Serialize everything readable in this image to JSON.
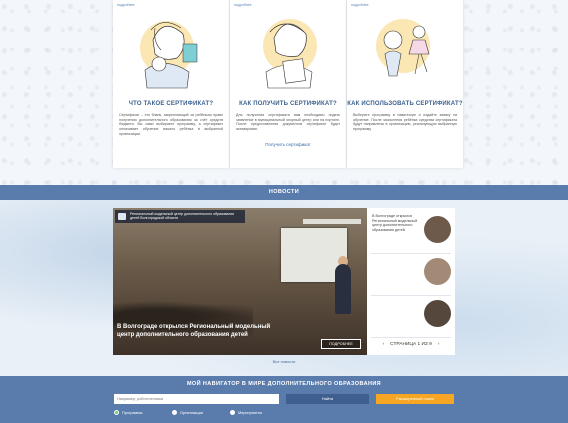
{
  "cards": [
    {
      "tag": "подробнее",
      "title": "ЧТО ТАКОЕ СЕРТИФИКАТ?",
      "text": "Сертификат – это бланк, закрепляющий за ребёнком право получения дополнительного образования за счёт средств бюджета. Вы сами выбираете программу, а сертификат оплачивает обучение вашего ребёнка в выбранной организации.",
      "link": ""
    },
    {
      "tag": "подробнее",
      "title": "КАК ПОЛУЧИТЬ СЕРТИФИКАТ?",
      "text": "Для получения сертификата вам необходимо подать заявление в муниципальный опорный центр или на портале. После предоставления документов сертификат будет активирован.",
      "link": "Получить сертификат"
    },
    {
      "tag": "подробнее",
      "title": "КАК ИСПОЛЬЗОВАТЬ СЕРТИФИКАТ?",
      "text": "Выберите программу в навигаторе и подайте заявку на обучение. После зачисления ребёнка средства сертификата будут направлены в организацию, реализующую выбранную программу.",
      "link": ""
    }
  ],
  "news_header": "НОВОСТИ",
  "main_news": {
    "badge": "Региональный модельный центр дополнительного образования детей Волгоградской области",
    "stripe": "",
    "caption": "В Волгограде открылся Региональный модельный центр дополнительного образования детей",
    "date": "",
    "more_label": "ПОДРОБНЕЕ"
  },
  "side_news": [
    {
      "text": "В Волгограде открылся Региональный модельный центр дополнительного образования детей"
    },
    {
      "text": ""
    },
    {
      "text": ""
    }
  ],
  "pager": {
    "prev": "‹",
    "label": "СТРАНИЦА 1 ИЗ 9",
    "next": "›"
  },
  "all_news_label": "Все новости",
  "navigator": {
    "title": "МОЙ НАВИГАТОР В МИРЕ ДОПОЛНИТЕЛЬНОГО ОБРАЗОВАНИЯ",
    "search_placeholder": "Например, робототехника",
    "find_label": "Найти",
    "extended_label": "Расширенный поиск",
    "radios": [
      "Программы",
      "Организации",
      "Мероприятия"
    ]
  },
  "colors": {
    "primary": "#5a7cad",
    "accent": "#f6a623",
    "title": "#3b5f8e"
  },
  "icons": [
    "chevron-left-icon",
    "chevron-right-icon",
    "radio-icon"
  ]
}
